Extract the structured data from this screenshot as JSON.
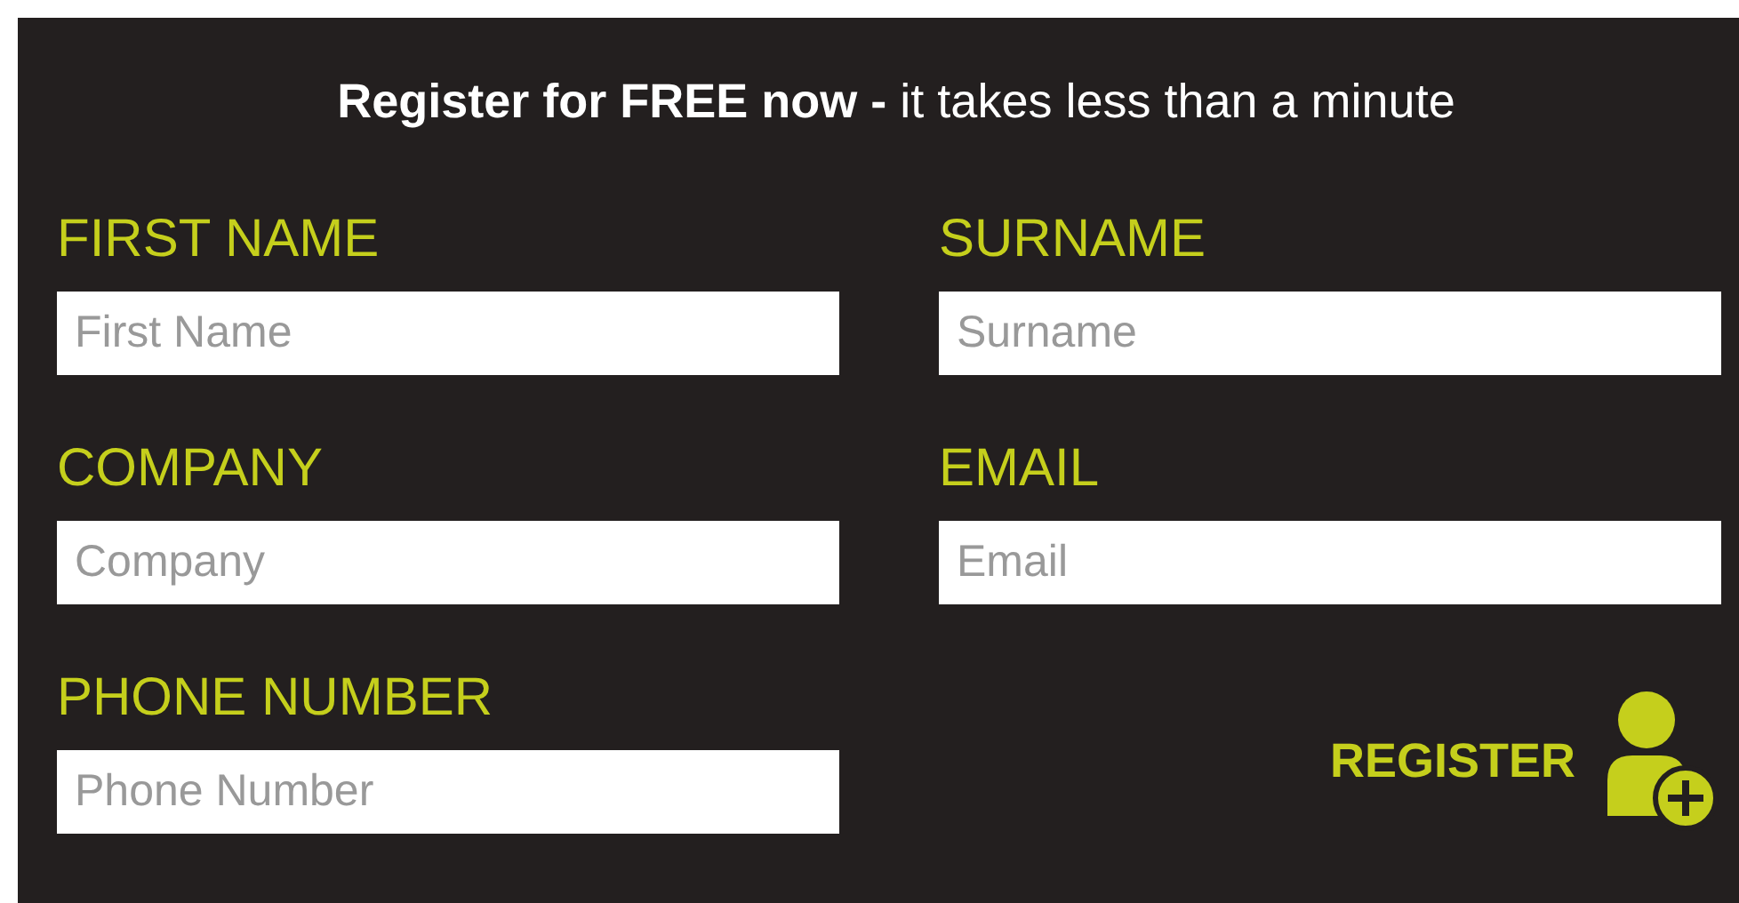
{
  "heading": "**Register for FREE now -** it takes less than a minute",
  "fields": [
    {
      "label": "FIRST NAME",
      "placeholder": "First Name"
    },
    {
      "label": "SURNAME",
      "placeholder": "Surname"
    },
    {
      "label": "COMPANY",
      "placeholder": "Company"
    },
    {
      "label": "EMAIL",
      "placeholder": "Email"
    },
    {
      "label": "PHONE NUMBER",
      "placeholder": "Phone Number"
    }
  ],
  "register_button": {
    "label": "REGISTER"
  }
}
